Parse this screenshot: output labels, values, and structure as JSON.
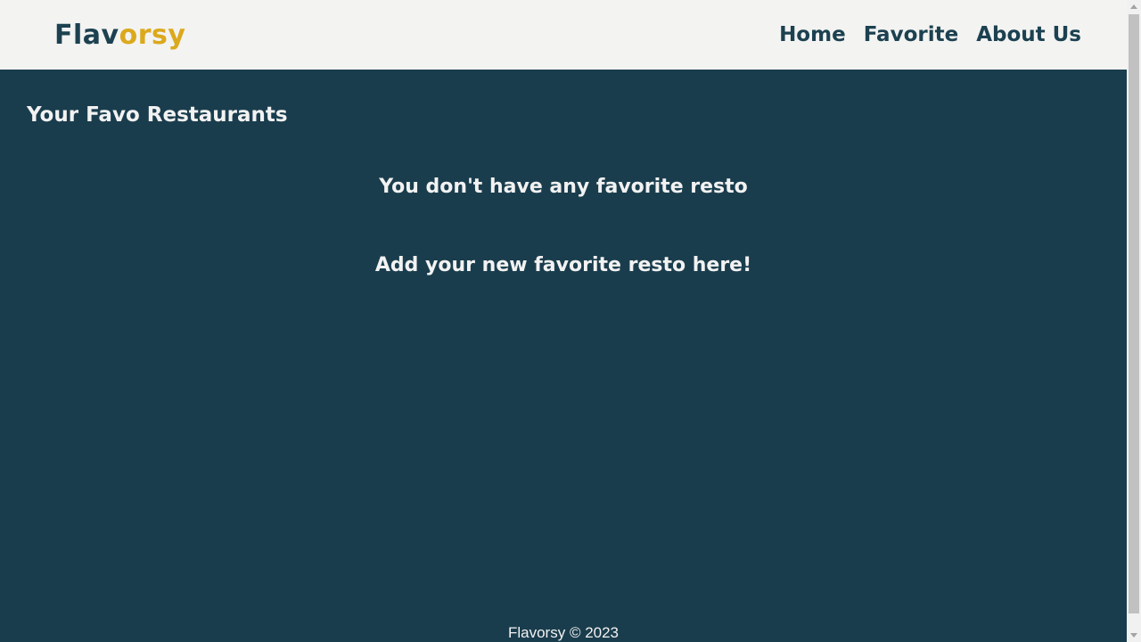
{
  "colors": {
    "header_bg": "#f3f3f2",
    "page_bg": "#1a3d4d",
    "brand_dark": "#1c4150",
    "brand_accent": "#dba91c",
    "text_light": "#f2f2f2"
  },
  "header": {
    "logo_part1": "Flav",
    "logo_part2": "orsy",
    "nav": [
      {
        "label": "Home"
      },
      {
        "label": "Favorite"
      },
      {
        "label": "About Us"
      }
    ]
  },
  "main": {
    "title": "Your Favo Restaurants",
    "empty_message": "You don't have any favorite resto",
    "add_message": "Add your new favorite resto here!"
  },
  "footer": {
    "text": "Flavorsy © 2023"
  }
}
